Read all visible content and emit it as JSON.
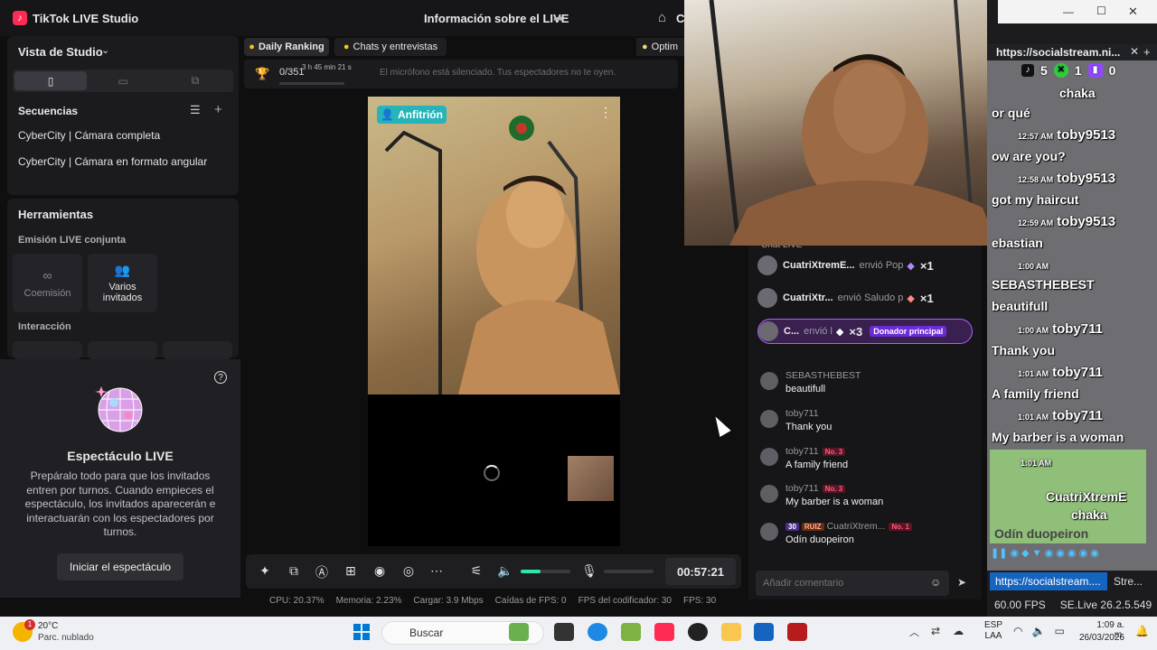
{
  "window": {
    "app_title": "TikTok LIVE Studio",
    "live_info_title": "Información sobre el LIVE",
    "home_partial": "C"
  },
  "studio": {
    "view_title": "Vista de Studio"
  },
  "sequences": {
    "title": "Secuencias",
    "items": [
      "CyberCity | Cámara completa",
      "CyberCity | Cámara en formato angular"
    ]
  },
  "tools": {
    "title": "Herramientas",
    "co_live_label": "Emisión LIVE conjunta",
    "commission_label": "Coemisión",
    "multi_guest_label": "Varios invitados",
    "interaction_label": "Interacción"
  },
  "show": {
    "title": "Espectáculo LIVE",
    "description": "Prepáralo todo para que los invitados entren por turnos. Cuando empieces el espectáculo, los invitados aparecerán e interactuarán con los espectadores por turnos.",
    "start_button": "Iniciar el espectáculo"
  },
  "top_tabs": {
    "daily_ranking": "Daily Ranking",
    "chats": "Chats y entrevistas",
    "optim": "Optim"
  },
  "ranking": {
    "count": "0/351",
    "timer": "3 h 45 min 21 s",
    "progress": 0.0
  },
  "notice": {
    "mic_muted": "El micrófono está silenciado. Tus espectadores no te oyen."
  },
  "preview": {
    "host_badge": "Anfitrión"
  },
  "controls": {
    "timer": "00:57:21",
    "volume_level": 0.4
  },
  "stats": {
    "cpu": "CPU:  20.37%",
    "memory": "Memoria:  2.23%",
    "load": "Cargar:  3.9 Mbps",
    "fps_drops": "Caídas de FPS:  0",
    "encoder_fps": "FPS del codificador:  30",
    "fps": "FPS:  30"
  },
  "chat": {
    "section_title": "Chat LIVE",
    "gifts": [
      {
        "user": "CuatriXtremE...",
        "action": "envió Pop",
        "count": "×1"
      },
      {
        "user": "CuatriXtr...",
        "action": "envió Saludo p",
        "count": "×1"
      },
      {
        "user": "C...",
        "action": "envió l",
        "count": "×3",
        "badge": "Donador principal"
      }
    ],
    "messages": [
      {
        "user": "SEBASTHEBEST",
        "text": "beautifull"
      },
      {
        "user": "toby711",
        "text": "Thank you"
      },
      {
        "user": "toby711",
        "rank": "No. 3",
        "text": "A family friend"
      },
      {
        "user": "toby711",
        "rank": "No. 3",
        "text": "My barber is a woman"
      },
      {
        "level": "30",
        "fan": "RUIZ",
        "user": "CuatriXtrem...",
        "rank": "No. 1",
        "text": "Odín duopeiron"
      }
    ],
    "input_placeholder": "Añadir comentario"
  },
  "social_stream": {
    "tab_title": "https://socialstream.ni...",
    "counts": {
      "tiktok": "5",
      "xtreme": "1",
      "twitch": "0"
    },
    "lines": [
      {
        "text": "chaka"
      },
      {
        "text": "or qué"
      },
      {
        "time": "12:57 AM",
        "name": "toby9513"
      },
      {
        "text": "ow are you?"
      },
      {
        "time": "12:58 AM",
        "name": "toby9513"
      },
      {
        "text": "got my haircut"
      },
      {
        "time": "12:59 AM",
        "name": "toby9513"
      },
      {
        "text": "ebastian"
      },
      {
        "time": "1:00 AM"
      },
      {
        "text": "SEBASTHEBEST"
      },
      {
        "text": "beautifull"
      },
      {
        "time": "1:00 AM",
        "name": "toby711"
      },
      {
        "text": "Thank you"
      },
      {
        "time": "1:01 AM",
        "name": "toby711"
      },
      {
        "text": "A family friend"
      },
      {
        "time": "1:01 AM",
        "name": "toby711"
      },
      {
        "text": "My barber is a woman"
      }
    ],
    "highlight": {
      "time": "1:01 AM",
      "name": "CuatriXtremE",
      "name2": "chaka",
      "message": "Odín duopeiron"
    },
    "url_tab": "https://socialstream....",
    "tab2": "Stre...",
    "fps": "60.00 FPS",
    "version": "SE.Live 26.2.5.549"
  },
  "taskbar": {
    "weather_temp": "20°C",
    "weather_desc": "Parc. nublado",
    "weather_alert": "1",
    "search_placeholder": "Buscar",
    "lang_line1": "ESP",
    "lang_line2": "LAA",
    "time": "1:09 a. m.",
    "date": "26/03/2026"
  }
}
